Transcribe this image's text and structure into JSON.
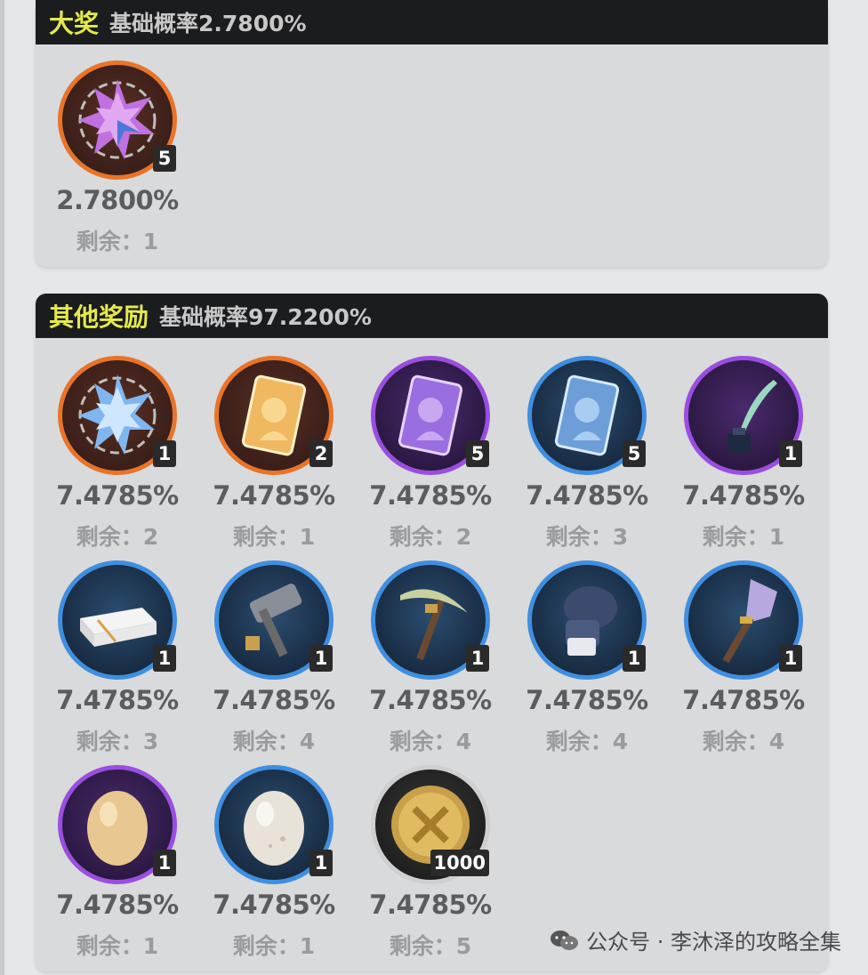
{
  "grand_prize": {
    "title": "大奖",
    "rate_text": "基础概率2.7800%",
    "items": [
      {
        "icon": "pink-star-crystal-icon",
        "ring": "orange",
        "qty": "5",
        "rate": "2.7800%",
        "remain": "剩余：1"
      }
    ]
  },
  "other_rewards": {
    "title": "其他奖励",
    "rate_text": "基础概率97.2200%",
    "items": [
      {
        "icon": "blue-star-crystal-icon",
        "ring": "orange",
        "qty": "1",
        "rate": "7.4785%",
        "remain": "剩余：2"
      },
      {
        "icon": "gold-character-card-icon",
        "ring": "orange",
        "qty": "2",
        "rate": "7.4785%",
        "remain": "剩余：1"
      },
      {
        "icon": "purple-character-card-icon",
        "ring": "purple",
        "qty": "5",
        "rate": "7.4785%",
        "remain": "剩余：2"
      },
      {
        "icon": "blue-character-card-icon",
        "ring": "blue",
        "qty": "5",
        "rate": "7.4785%",
        "remain": "剩余：3"
      },
      {
        "icon": "quill-inkwell-icon",
        "ring": "purple",
        "qty": "1",
        "rate": "7.4785%",
        "remain": "剩余：1"
      },
      {
        "icon": "cloth-towel-icon",
        "ring": "blue",
        "qty": "1",
        "rate": "7.4785%",
        "remain": "剩余：3"
      },
      {
        "icon": "hammer-icon",
        "ring": "blue",
        "qty": "1",
        "rate": "7.4785%",
        "remain": "剩余：4"
      },
      {
        "icon": "pickaxe-icon",
        "ring": "blue",
        "qty": "1",
        "rate": "7.4785%",
        "remain": "剩余：4"
      },
      {
        "icon": "gauntlet-icon",
        "ring": "blue",
        "qty": "1",
        "rate": "7.4785%",
        "remain": "剩余：4"
      },
      {
        "icon": "shovel-icon",
        "ring": "blue",
        "qty": "1",
        "rate": "7.4785%",
        "remain": "剩余：4"
      },
      {
        "icon": "golden-egg-icon",
        "ring": "purple",
        "qty": "1",
        "rate": "7.4785%",
        "remain": "剩余：1"
      },
      {
        "icon": "white-egg-icon",
        "ring": "blue",
        "qty": "1",
        "rate": "7.4785%",
        "remain": "剩余：1"
      },
      {
        "icon": "gold-coin-icon",
        "ring": "gray",
        "qty": "1000",
        "rate": "7.4785%",
        "remain": "剩余：5"
      }
    ]
  },
  "watermark": {
    "text": "公众号 · 李沐泽的攻略全集",
    "icon": "wechat-icon"
  },
  "colors": {
    "orange": "#e8742a",
    "purple": "#9a4ee0",
    "blue": "#3f8ee0",
    "title": "#e4e94c"
  }
}
